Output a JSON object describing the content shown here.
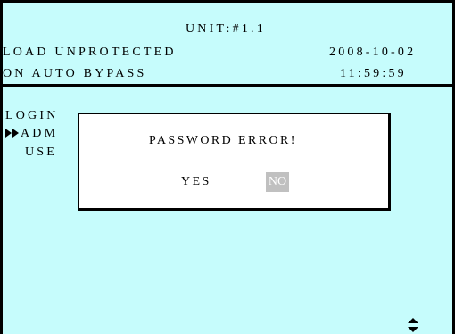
{
  "header": {
    "unit": "UNIT:#1.1",
    "status_line1": "LOAD UNPROTECTED",
    "status_line2": "ON AUTO BYPASS",
    "date": "2008-10-02",
    "time": "11:59:59"
  },
  "menu": {
    "title": "LOGIN",
    "items": [
      {
        "label": "ADM",
        "selected": true
      },
      {
        "label": "USE",
        "selected": false
      }
    ]
  },
  "dialog": {
    "message": "PASSWORD ERROR!",
    "yes_label": "YES",
    "no_label": "NO",
    "selected": "NO"
  },
  "icons": {
    "selection_pointer": "double-right-triangle-icon",
    "scroll": "up-down-arrow-icon"
  },
  "colors": {
    "background": "#c6fcfc",
    "dialog": "#ffffff",
    "highlight": "#c0c0c0"
  }
}
